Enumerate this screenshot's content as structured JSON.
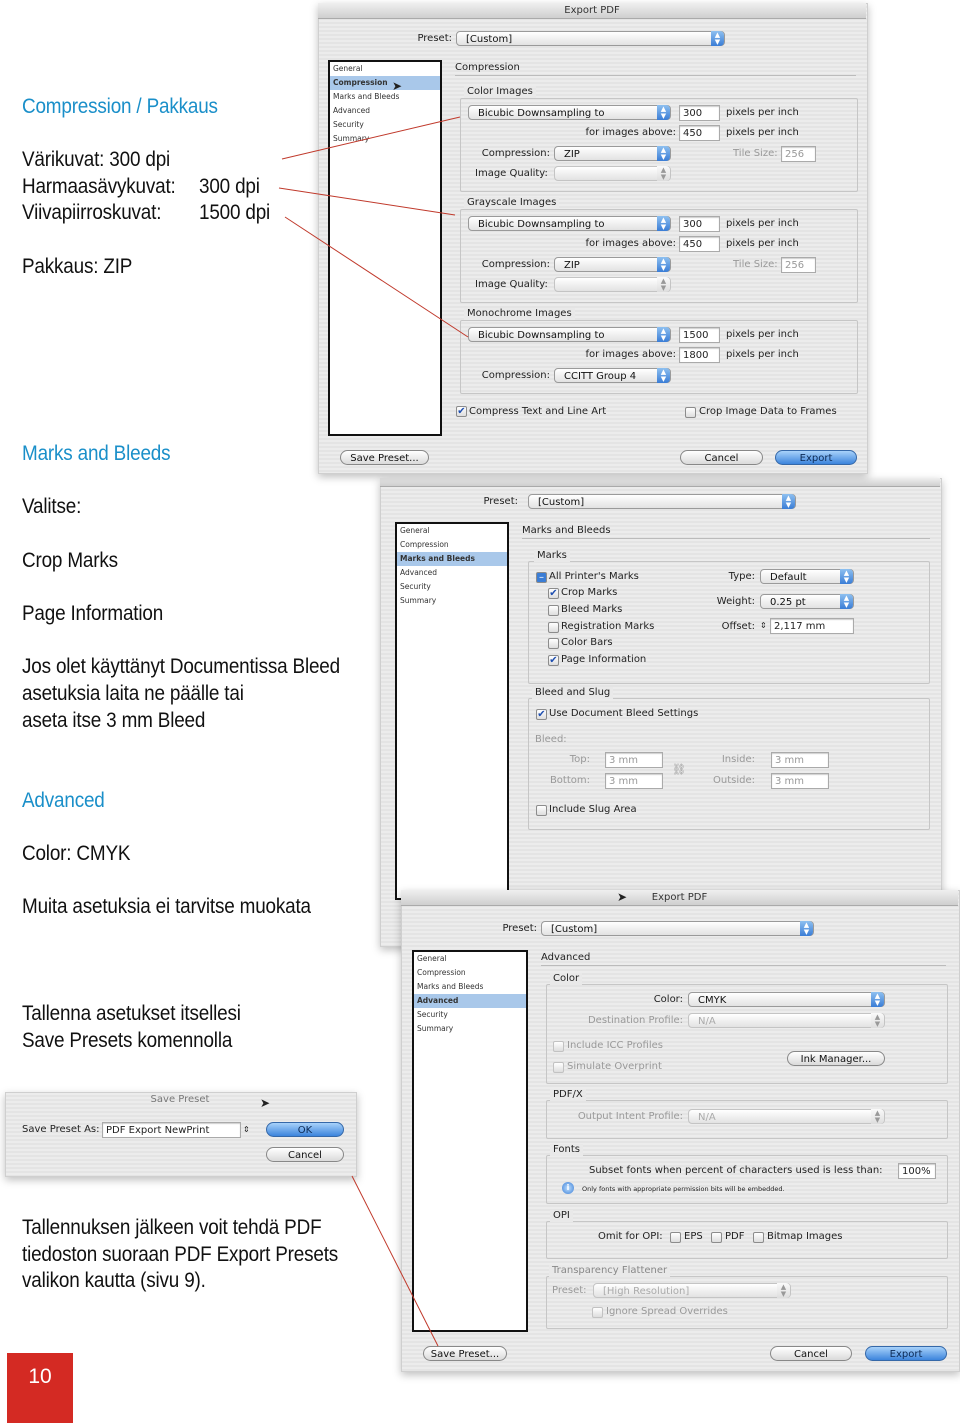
{
  "left": {
    "compression_heading": "Compression / Pakkaus",
    "color_line": "Värikuvat: 300 dpi",
    "gray_label": "Harmaasävykuvat:",
    "gray_value": "300 dpi",
    "line_label": "Viivapiirroskuvat:",
    "line_value": "1500 dpi",
    "packing": "Pakkaus:  ZIP",
    "marks_heading": "Marks and Bleeds",
    "choose": "Valitse:",
    "crop": "Crop Marks",
    "pageinfo": "Page Information",
    "bleed_text": [
      "Jos olet käyttänyt Documentissa Bleed",
      "asetuksia laita ne päälle tai",
      "aseta itse 3 mm Bleed"
    ],
    "advanced_heading": "Advanced",
    "color_cmyk": "Color: CMYK",
    "no_change": "Muita asetuksia ei tarvitse muokata",
    "save_text": [
      "Tallenna asetukset itsellesi",
      "Save Presets komennolla"
    ],
    "after_text": [
      "Tallennuksen jälkeen voit tehdä PDF",
      "tiedoston suoraan PDF Export Presets",
      "valikon kautta (sivu 9)."
    ],
    "page_number": "10"
  },
  "sidebar_items": [
    "General",
    "Compression",
    "Marks and Bleeds",
    "Advanced",
    "Security",
    "Summary"
  ],
  "common": {
    "title": "Export PDF",
    "preset_label": "Preset:",
    "preset_value": "[Custom]",
    "save_preset": "Save Preset...",
    "cancel": "Cancel",
    "export": "Export"
  },
  "dlg1": {
    "section": "Compression",
    "ppi": "pixels per inch",
    "above": "for images above:",
    "compression": "Compression:",
    "quality": "Image Quality:",
    "tile": "Tile Size:",
    "color": {
      "label": "Color Images",
      "method": "Bicubic Downsampling to",
      "res": "300",
      "above": "450",
      "comp": "ZIP",
      "tile": "256"
    },
    "gray": {
      "label": "Grayscale Images",
      "method": "Bicubic Downsampling to",
      "res": "300",
      "above": "450",
      "comp": "ZIP",
      "tile": "256"
    },
    "mono": {
      "label": "Monochrome Images",
      "method": "Bicubic Downsampling to",
      "res": "1500",
      "above": "1800",
      "comp": "CCITT Group 4"
    },
    "compress_text": "Compress Text and Line Art",
    "compress_text_checked": true,
    "crop_image": "Crop Image Data to Frames",
    "crop_image_checked": false
  },
  "dlg2": {
    "section": "Marks and Bleeds",
    "marks_group": "Marks",
    "all_marks": "All Printer's Marks",
    "marks": [
      {
        "label": "Crop Marks",
        "checked": true
      },
      {
        "label": "Bleed Marks",
        "checked": false
      },
      {
        "label": "Registration Marks",
        "checked": false
      },
      {
        "label": "Color Bars",
        "checked": false
      },
      {
        "label": "Page Information",
        "checked": true
      }
    ],
    "type_label": "Type:",
    "type_value": "Default",
    "weight_label": "Weight:",
    "weight_value": "0.25 pt",
    "offset_label": "Offset:",
    "offset_value": "2,117 mm",
    "bleed_group": "Bleed and Slug",
    "use_doc_bleed": "Use Document Bleed Settings",
    "bleed_label": "Bleed:",
    "top_label": "Top:",
    "top": "3 mm",
    "bottom_label": "Bottom:",
    "bottom": "3 mm",
    "inside_label": "Inside:",
    "inside": "3 mm",
    "outside_label": "Outside:",
    "outside": "3 mm",
    "slug": "Include Slug Area"
  },
  "dlg3": {
    "section": "Advanced",
    "color_group": "Color",
    "color_label": "Color:",
    "color_value": "CMYK",
    "dest_label": "Destination Profile:",
    "dest_value": "N/A",
    "icc": "Include ICC Profiles",
    "overprint": "Simulate Overprint",
    "ink_manager": "Ink Manager...",
    "pdfx_group": "PDF/X",
    "intent_label": "Output Intent Profile:",
    "intent_value": "N/A",
    "fonts_group": "Fonts",
    "subset_label": "Subset fonts when percent of characters used is less than:",
    "subset_value": "100%",
    "fonts_note": "Only fonts with appropriate permission bits will be embedded.",
    "opi_group": "OPI",
    "omit_label": "Omit for OPI:",
    "opi_eps": "EPS",
    "opi_pdf": "PDF",
    "opi_bitmap": "Bitmap Images",
    "flattener_group": "Transparency Flattener",
    "flat_preset_label": "Preset:",
    "flat_preset_value": "[High Resolution]",
    "ignore_spread": "Ignore Spread Overrides"
  },
  "save_dialog": {
    "title": "Save Preset",
    "label": "Save Preset As:",
    "value": "PDF Export NewPrint",
    "ok": "OK",
    "cancel": "Cancel"
  },
  "colors": {
    "heading": "#1a8fc9",
    "page_box": "#d42a23",
    "callout_line": "#c0392b",
    "aqua": "#3a7dd6"
  }
}
